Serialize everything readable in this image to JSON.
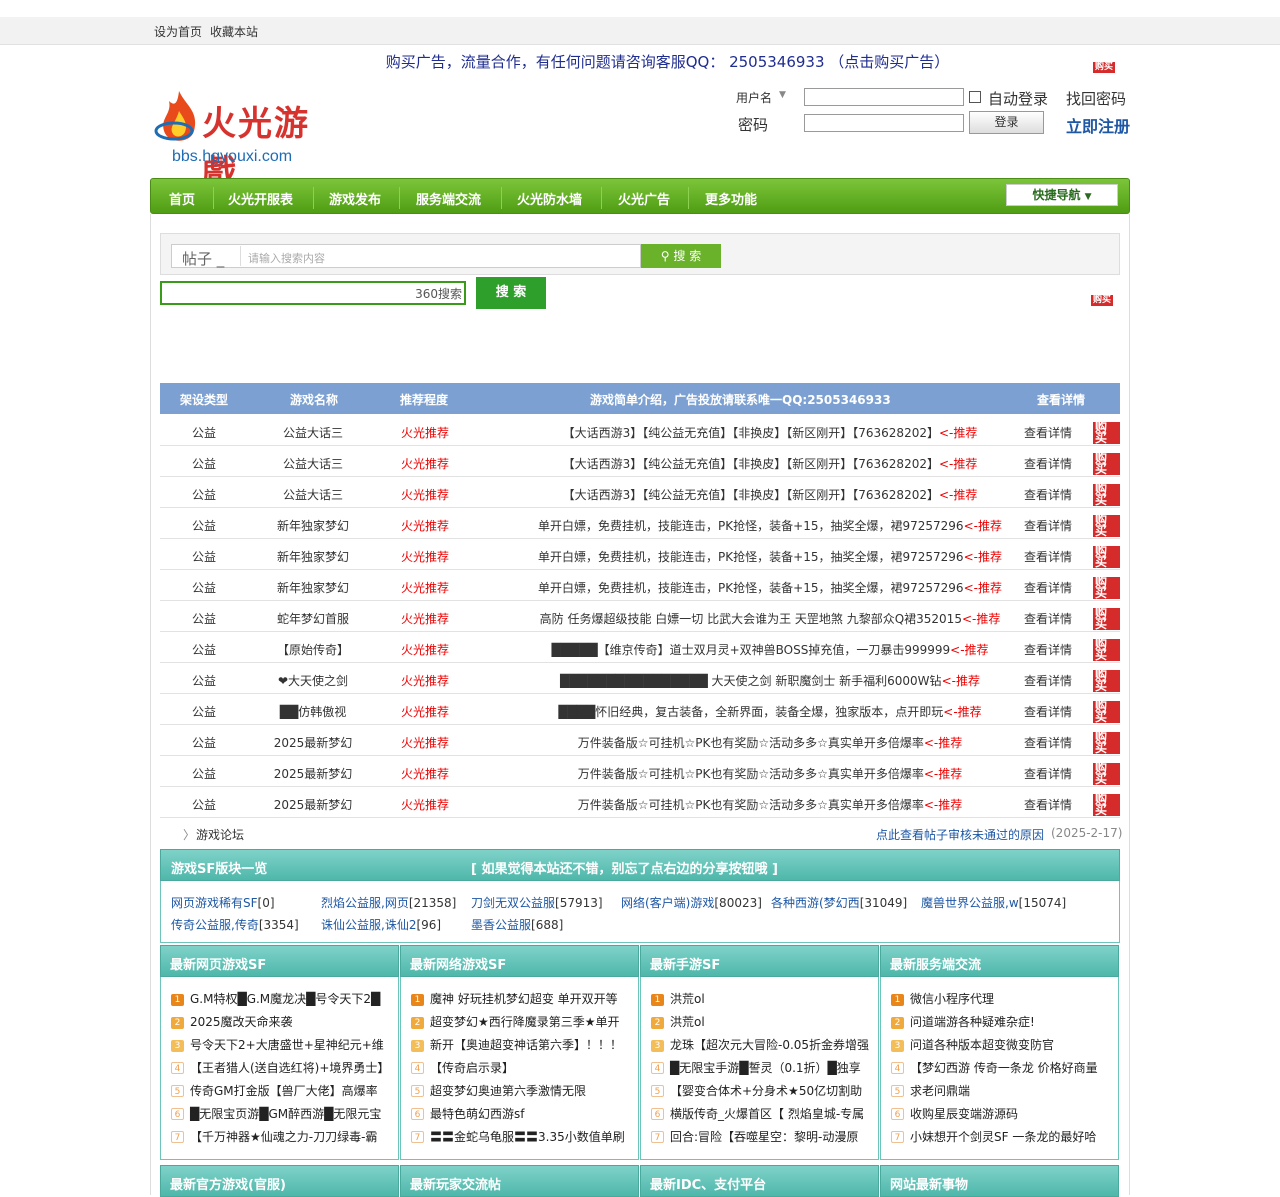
{
  "topbar": {
    "home": "设为首页",
    "fav": "收藏本站"
  },
  "ad": {
    "text": "购买广告，流量合作，有任何问题请咨询客服QQ： 2505346933 （点击购买广告）",
    "buy": "购买"
  },
  "logo": {
    "name": "火光游戲",
    "url": "bbs.hgyouxi.com"
  },
  "login": {
    "user_label": "用户名",
    "pass_label": "密码",
    "auto": "自动登录",
    "find": "找回密码",
    "login_btn": "登录",
    "register": "立即注册"
  },
  "nav": {
    "items": [
      "首页",
      "火光开服表",
      "游戏发布",
      "服务端交流",
      "火光防水墙",
      "火光广告",
      "更多功能"
    ],
    "quick": "快捷导航"
  },
  "search": {
    "type": "帖子",
    "placeholder": "请输入搜索内容",
    "btn": "搜 索",
    "s360": "360搜索",
    "btn2": "搜 索"
  },
  "table": {
    "headers": [
      "架设类型",
      "游戏名称",
      "推荐程度",
      "游戏简单介绍，广告投放请联系唯一QQ:2505346933",
      "查看详情"
    ],
    "rows": [
      [
        "公益",
        "公益大话三",
        "火光推荐",
        "【大话西游3】【纯公益无充值】【非换皮】【新区刚开】【763628202】",
        "<-推荐",
        "查看详情"
      ],
      [
        "公益",
        "公益大话三",
        "火光推荐",
        "【大话西游3】【纯公益无充值】【非换皮】【新区刚开】【763628202】",
        "<-推荐",
        "查看详情"
      ],
      [
        "公益",
        "公益大话三",
        "火光推荐",
        "【大话西游3】【纯公益无充值】【非换皮】【新区刚开】【763628202】",
        "<-推荐",
        "查看详情"
      ],
      [
        "公益",
        "新年独家梦幻",
        "火光推荐",
        "单开白嫖，免费挂机，技能连击，PK抢怪，装备+15，抽奖全爆，裙97257296",
        "<-推荐",
        "查看详情"
      ],
      [
        "公益",
        "新年独家梦幻",
        "火光推荐",
        "单开白嫖，免费挂机，技能连击，PK抢怪，装备+15，抽奖全爆，裙97257296",
        "<-推荐",
        "查看详情"
      ],
      [
        "公益",
        "新年独家梦幻",
        "火光推荐",
        "单开白嫖，免费挂机，技能连击，PK抢怪，装备+15，抽奖全爆，裙97257296",
        "<-推荐",
        "查看详情"
      ],
      [
        "公益",
        "蛇年梦幻首服",
        "火光推荐",
        "高防 任务爆超级技能 白嫖一切 比武大会谁为王 天罡地煞 九黎部众Q裙352015",
        "<-推荐",
        "查看详情"
      ],
      [
        "公益",
        "【原始传奇】",
        "火光推荐",
        "█████【维京传奇】道士双月灵+双神兽BOSS掉充值，一刀暴击999999",
        "<-推荐",
        "查看详情"
      ],
      [
        "公益",
        "❤大天使之剑",
        "火光推荐",
        "████████████████ 大天使之剑 新职魔剑士 新手福利6000W钻",
        "<-推荐",
        "查看详情"
      ],
      [
        "公益",
        "██仿韩傲视",
        "火光推荐",
        "████怀旧经典，复古装备，全新界面，装备全爆，独家版本，点开即玩",
        "<-推荐",
        "查看详情"
      ],
      [
        "公益",
        "2025最新梦幻",
        "火光推荐",
        "万件装备版☆可挂机☆PK也有奖励☆活动多多☆真实单开多倍爆率",
        "<-推荐",
        "查看详情"
      ],
      [
        "公益",
        "2025最新梦幻",
        "火光推荐",
        "万件装备版☆可挂机☆PK也有奖励☆活动多多☆真实单开多倍爆率",
        "<-推荐",
        "查看详情"
      ],
      [
        "公益",
        "2025最新梦幻",
        "火光推荐",
        "万件装备版☆可挂机☆PK也有奖励☆活动多多☆真实单开多倍爆率",
        "<-推荐",
        "查看详情"
      ]
    ]
  },
  "breadcrumb": {
    "arrow": "〉",
    "text": "游戏论坛",
    "notice": "点此查看帖子审核未通过的原因",
    "date": "(2025-2-17)"
  },
  "sf": {
    "title": "游戏SF版块一览",
    "slogan": "[ 如果觉得本站还不错，别忘了点右边的分享按钮哦 ]",
    "links": [
      [
        "网页游戏稀有SF",
        "[0]"
      ],
      [
        "烈焰公益服,网页",
        "[21358]"
      ],
      [
        "刀剑无双公益服",
        "[57913]"
      ],
      [
        "网络(客户端)游戏",
        "[80023]"
      ],
      [
        "各种西游(梦幻西",
        "[31049]"
      ],
      [
        "魔兽世界公益服,w",
        "[15074]"
      ],
      [
        "传奇公益服,传奇",
        "[3354]"
      ],
      [
        "诛仙公益服,诛仙2",
        "[96]"
      ],
      [
        "墨香公益服",
        "[688]"
      ]
    ]
  },
  "cols": [
    {
      "title": "最新网页游戏SF",
      "items": [
        "G.M特权█G.M魔龙决█号令天下2█",
        "2025魔改天命来袭",
        "号令天下2+大唐盛世+星神纪元+维",
        "【王者猎人(送自选红将)+境界勇士】",
        "传奇GM打金版【兽厂大佬】高爆率",
        "█无限宝页游█GM醉西游█无限元宝",
        "【千万神器★仙魂之力-刀刀绿毒-霸"
      ]
    },
    {
      "title": "最新网络游戏SF",
      "items": [
        "魔神 好玩挂机梦幻超变 单开双开等",
        "超变梦幻★西行降魔录第三季★单开",
        "新开【奥迪超变神话第六季】！！！",
        "【传奇启示录】",
        "超变梦幻奥迪第六季激情无限",
        "最特色萌幻西游sf",
        "〓〓金蛇乌龟服〓〓3.35小数值单刷"
      ]
    },
    {
      "title": "最新手游SF",
      "items": [
        "洪荒ol",
        "洪荒ol",
        "龙珠【超次元大冒险-0.05折金券增强",
        "█无限宝手游█誓灵（0.1折）█独享",
        "【婴变合体术+分身术★50亿切割助",
        "横版传奇_火爆首区【 烈焰皇城-专属",
        "回合:冒险【吞噬星空：黎明-动漫原"
      ]
    },
    {
      "title": "最新服务端交流",
      "items": [
        "微信小程序代理",
        "问道端游各种疑难杂症!",
        "问道各种版本超变微变防官",
        "【梦幻西游 传奇一条龙 价格好商量",
        "求老问鼎端",
        "收购星辰变端游源码",
        "小妹想开个剑灵SF 一条龙的最好哈"
      ]
    }
  ],
  "bottom_titles": [
    "最新官方游戏(官服)",
    "最新玩家交流帖",
    "最新IDC、支付平台",
    "网站最新事物"
  ],
  "colors": {
    "nav": "#5aa61c",
    "teal": "#5cbdb2",
    "blue_head": "#7ba0d1",
    "red": "#e00000"
  }
}
